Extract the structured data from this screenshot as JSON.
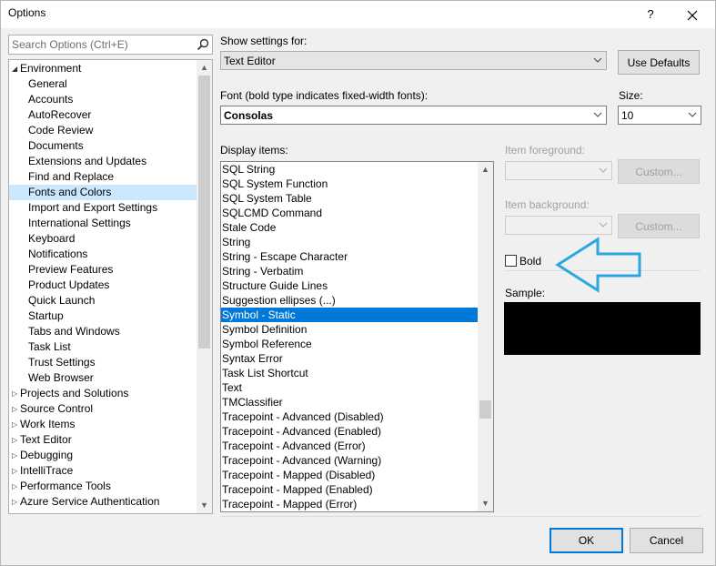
{
  "window": {
    "title": "Options",
    "help_label": "?",
    "close_icon": "close-icon"
  },
  "search": {
    "placeholder": "Search Options (Ctrl+E)",
    "icon": "search-icon"
  },
  "tree": {
    "items": [
      {
        "label": "Environment",
        "level": 0,
        "expanded": true
      },
      {
        "label": "General",
        "level": 1
      },
      {
        "label": "Accounts",
        "level": 1
      },
      {
        "label": "AutoRecover",
        "level": 1
      },
      {
        "label": "Code Review",
        "level": 1
      },
      {
        "label": "Documents",
        "level": 1
      },
      {
        "label": "Extensions and Updates",
        "level": 1
      },
      {
        "label": "Find and Replace",
        "level": 1
      },
      {
        "label": "Fonts and Colors",
        "level": 1,
        "selected": true
      },
      {
        "label": "Import and Export Settings",
        "level": 1
      },
      {
        "label": "International Settings",
        "level": 1
      },
      {
        "label": "Keyboard",
        "level": 1
      },
      {
        "label": "Notifications",
        "level": 1
      },
      {
        "label": "Preview Features",
        "level": 1
      },
      {
        "label": "Product Updates",
        "level": 1
      },
      {
        "label": "Quick Launch",
        "level": 1
      },
      {
        "label": "Startup",
        "level": 1
      },
      {
        "label": "Tabs and Windows",
        "level": 1
      },
      {
        "label": "Task List",
        "level": 1
      },
      {
        "label": "Trust Settings",
        "level": 1
      },
      {
        "label": "Web Browser",
        "level": 1
      },
      {
        "label": "Projects and Solutions",
        "level": 0,
        "expanded": false
      },
      {
        "label": "Source Control",
        "level": 0,
        "expanded": false
      },
      {
        "label": "Work Items",
        "level": 0,
        "expanded": false
      },
      {
        "label": "Text Editor",
        "level": 0,
        "expanded": false
      },
      {
        "label": "Debugging",
        "level": 0,
        "expanded": false
      },
      {
        "label": "IntelliTrace",
        "level": 0,
        "expanded": false
      },
      {
        "label": "Performance Tools",
        "level": 0,
        "expanded": false
      },
      {
        "label": "Azure Service Authentication",
        "level": 0,
        "expanded": false
      }
    ]
  },
  "settings": {
    "show_settings_label": "Show settings for:",
    "show_settings_value": "Text Editor",
    "use_defaults_label": "Use Defaults",
    "font_label": "Font (bold type indicates fixed-width fonts):",
    "font_value": "Consolas",
    "size_label": "Size:",
    "size_value": "10",
    "display_items_label": "Display items:",
    "item_foreground_label": "Item foreground:",
    "item_background_label": "Item background:",
    "custom_label": "Custom...",
    "bold_label": "Bold",
    "bold_checked": false,
    "sample_label": "Sample:"
  },
  "display_items": [
    {
      "label": "SQL String"
    },
    {
      "label": "SQL System Function"
    },
    {
      "label": "SQL System Table"
    },
    {
      "label": "SQLCMD Command"
    },
    {
      "label": "Stale Code"
    },
    {
      "label": "String"
    },
    {
      "label": "String - Escape Character"
    },
    {
      "label": "String - Verbatim"
    },
    {
      "label": "Structure Guide Lines"
    },
    {
      "label": "Suggestion ellipses (...)"
    },
    {
      "label": "Symbol - Static",
      "selected": true
    },
    {
      "label": "Symbol Definition"
    },
    {
      "label": "Symbol Reference"
    },
    {
      "label": "Syntax Error"
    },
    {
      "label": "Task List Shortcut"
    },
    {
      "label": "Text"
    },
    {
      "label": "TMClassifier"
    },
    {
      "label": "Tracepoint - Advanced (Disabled)"
    },
    {
      "label": "Tracepoint - Advanced (Enabled)"
    },
    {
      "label": "Tracepoint - Advanced (Error)"
    },
    {
      "label": "Tracepoint - Advanced (Warning)"
    },
    {
      "label": "Tracepoint - Mapped (Disabled)"
    },
    {
      "label": "Tracepoint - Mapped (Enabled)"
    },
    {
      "label": "Tracepoint - Mapped (Error)"
    }
  ],
  "footer": {
    "ok_label": "OK",
    "cancel_label": "Cancel"
  },
  "colors": {
    "accent": "#0078d7",
    "annotation_arrow": "#29a8e0",
    "sample_background": "#000000"
  }
}
